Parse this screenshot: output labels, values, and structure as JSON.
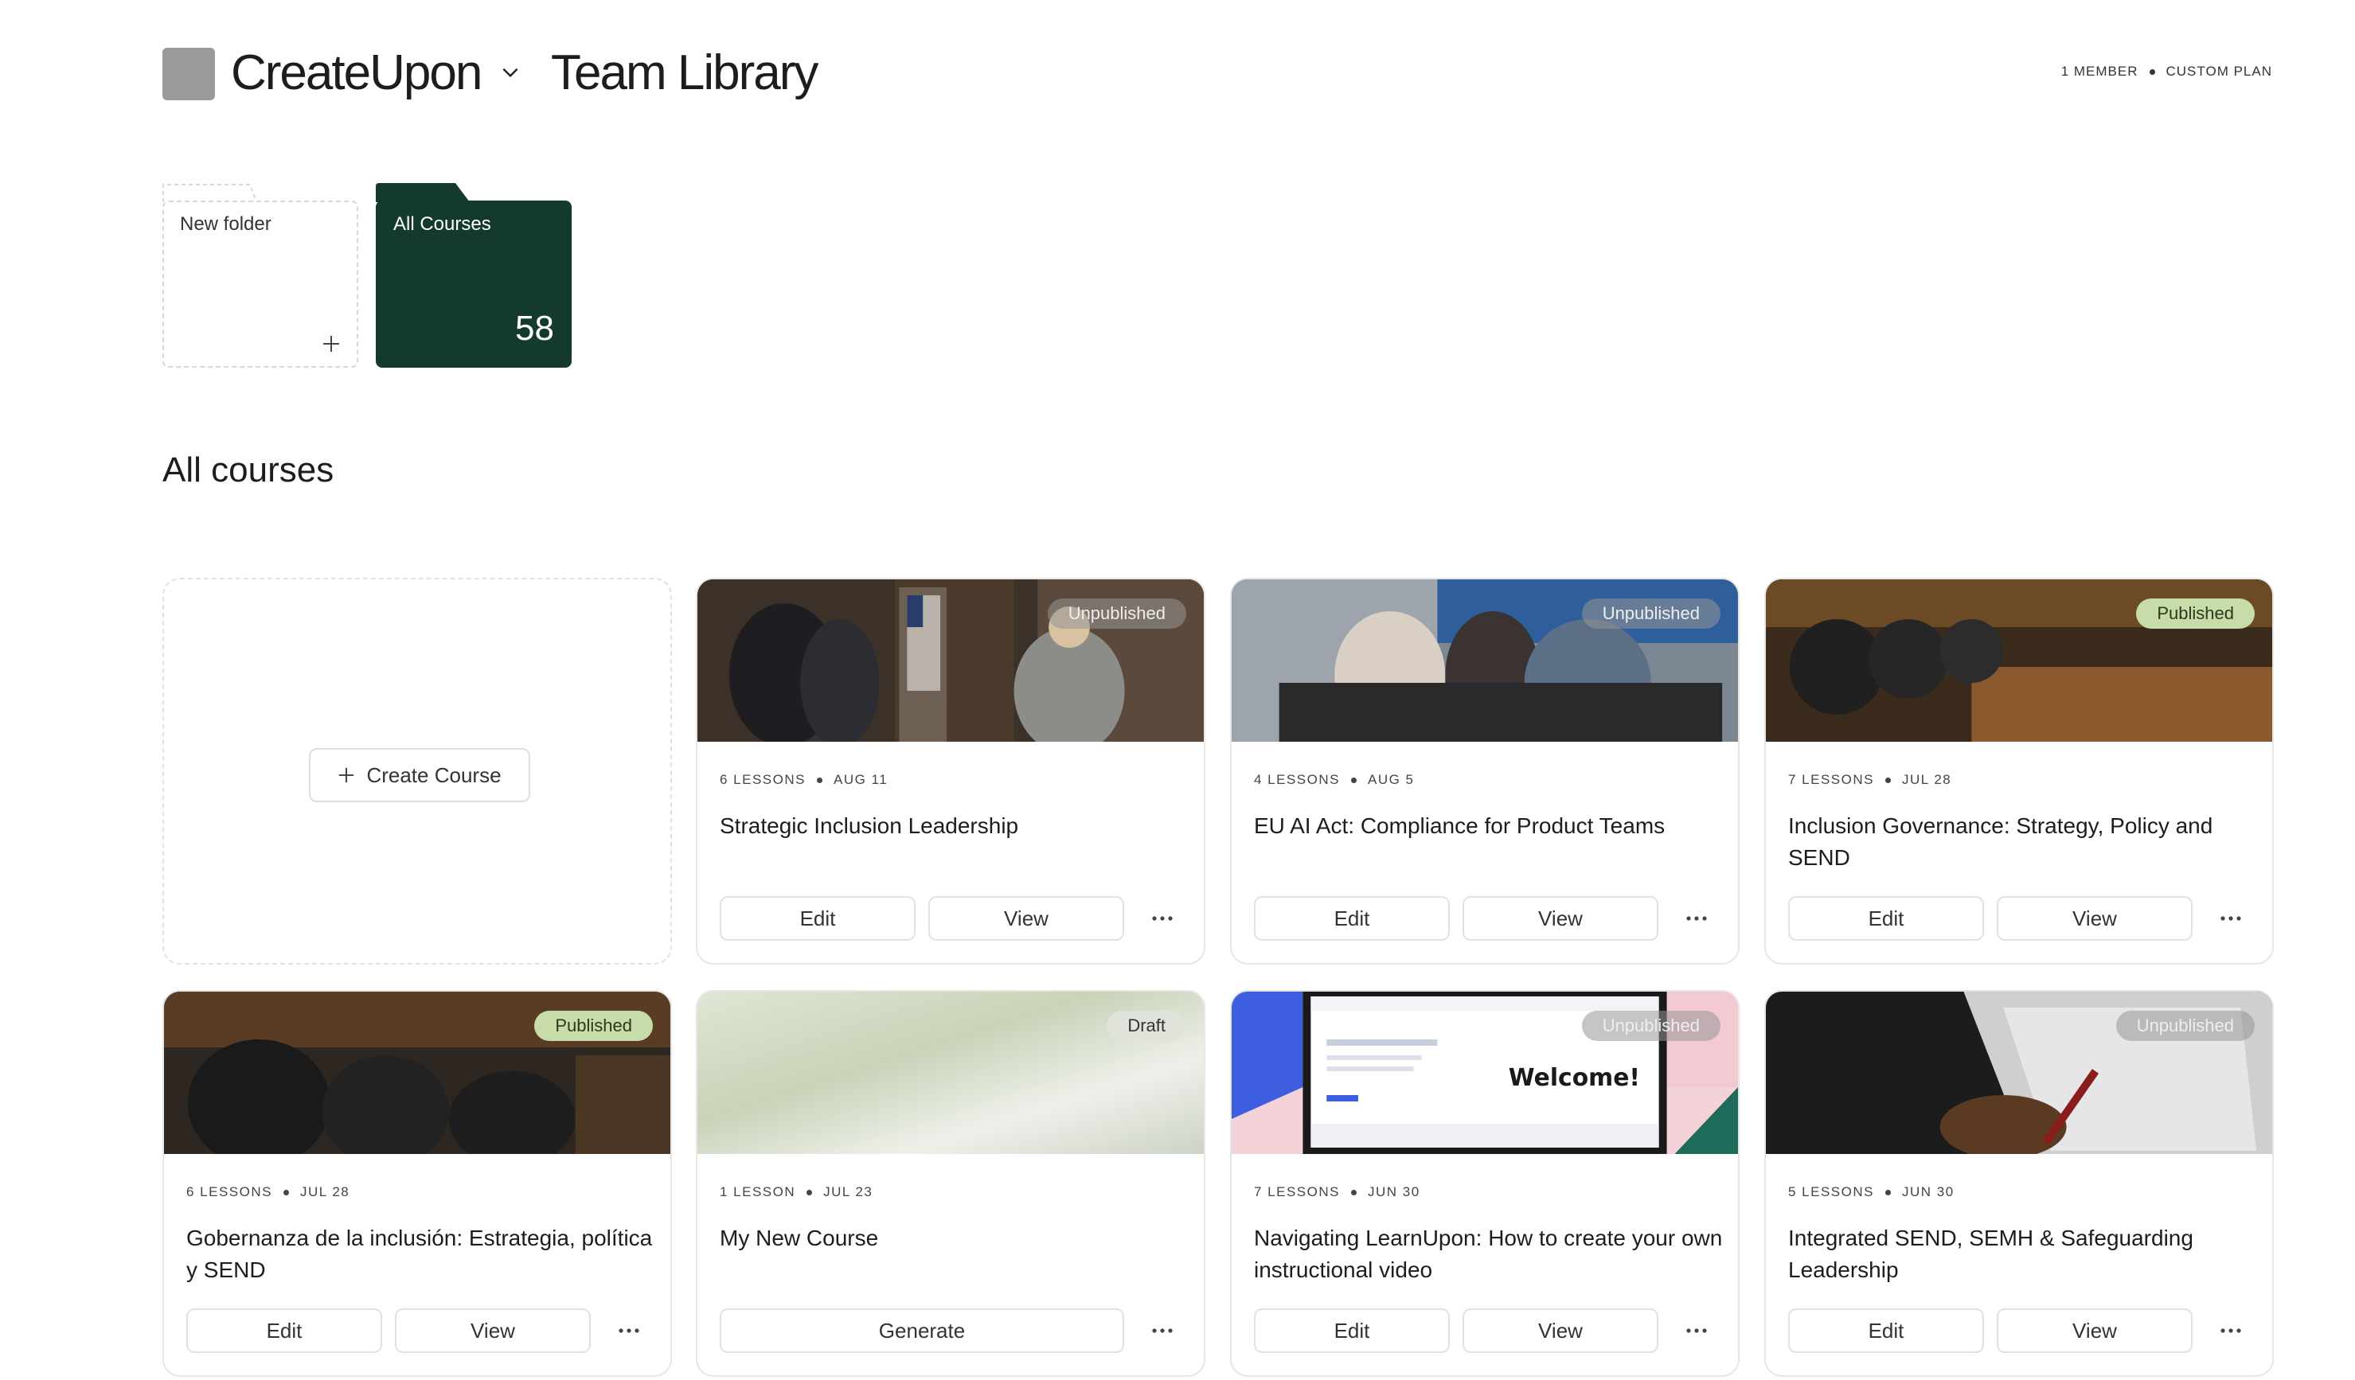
{
  "header": {
    "brand": "CreateUpon",
    "library": "Team Library",
    "members": "1 MEMBER",
    "plan": "CUSTOM PLAN"
  },
  "folders": {
    "new_label": "New folder",
    "all_label": "All Courses",
    "all_count": "58"
  },
  "section_title": "All courses",
  "create_label": "Create Course",
  "courses": [
    {
      "lessons": "6 LESSONS",
      "date": "AUG 11",
      "title": "Strategic Inclusion Leadership",
      "status": "Unpublished",
      "edit": "Edit",
      "view": "View"
    },
    {
      "lessons": "4 LESSONS",
      "date": "AUG 5",
      "title": "EU AI Act: Compliance for Product Teams",
      "status": "Unpublished",
      "edit": "Edit",
      "view": "View"
    },
    {
      "lessons": "7 LESSONS",
      "date": "JUL 28",
      "title": "Inclusion Governance: Strategy, Policy and SEND",
      "status": "Published",
      "edit": "Edit",
      "view": "View"
    },
    {
      "lessons": "6 LESSONS",
      "date": "JUL 28",
      "title": "Gobernanza de la inclusión: Estrategia, política y SEND",
      "status": "Published",
      "edit": "Edit",
      "view": "View"
    },
    {
      "lessons": "1 LESSON",
      "date": "JUL 23",
      "title": "My New Course",
      "status": "Draft",
      "generate": "Generate"
    },
    {
      "lessons": "7 LESSONS",
      "date": "JUN 30",
      "title": "Navigating LearnUpon: How to create your own instructional video",
      "status": "Unpublished",
      "edit": "Edit",
      "view": "View",
      "thumb_text": "Welcome!"
    },
    {
      "lessons": "5 LESSONS",
      "date": "JUN 30",
      "title": "Integrated SEND, SEMH & Safeguarding Leadership",
      "status": "Unpublished",
      "edit": "Edit",
      "view": "View"
    }
  ],
  "colors": {
    "folder_dark": "#143a2f",
    "published_badge": "#c7dca9"
  }
}
